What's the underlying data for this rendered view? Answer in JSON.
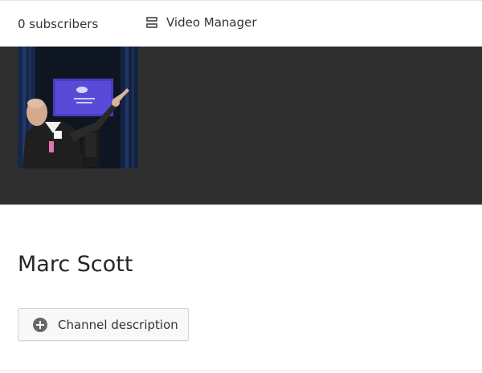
{
  "header": {
    "subscribers_text": "0 subscribers",
    "video_manager_label": "Video Manager",
    "video_manager_icon": "video-manager-icon"
  },
  "banner": {
    "background_color": "#2f2f2f",
    "avatar_icon": "channel-avatar-photo"
  },
  "channel": {
    "name": "Marc Scott"
  },
  "actions": {
    "description_button_label": "Channel description",
    "description_button_icon": "plus-circle-icon"
  }
}
